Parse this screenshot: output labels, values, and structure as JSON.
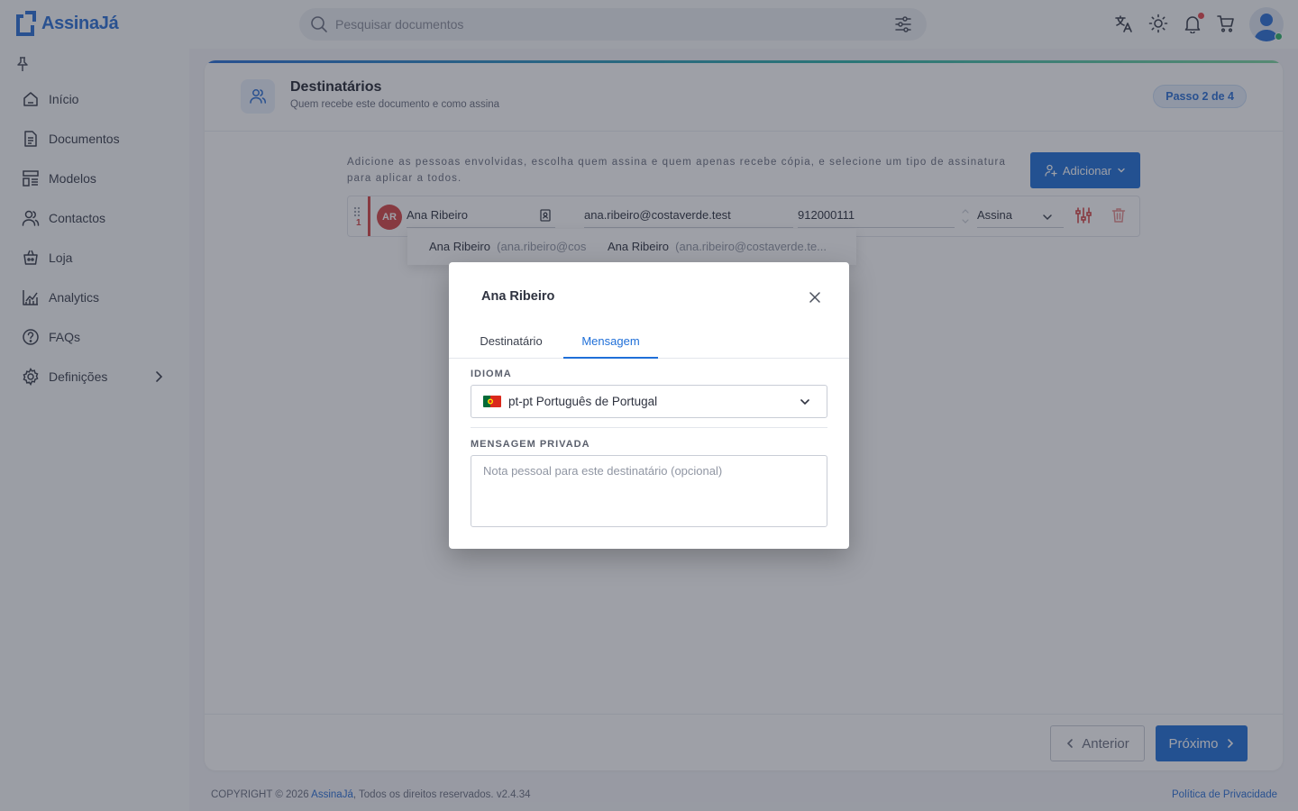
{
  "app": {
    "name": "AssinaJá",
    "brand_color": "#2a6fd6",
    "accent_color": "#1f6fd8"
  },
  "topbar": {
    "search_placeholder": "Pesquisar documentos",
    "icons": [
      "search-icon",
      "filter-icon",
      "translate-icon",
      "theme-icon",
      "bell-icon",
      "cart-icon",
      "user-avatar"
    ]
  },
  "sidebar": {
    "items": [
      {
        "label": "Início",
        "icon": "home-icon"
      },
      {
        "label": "Documentos",
        "icon": "document-icon"
      },
      {
        "label": "Modelos",
        "icon": "template-icon"
      },
      {
        "label": "Contactos",
        "icon": "contacts-icon"
      },
      {
        "label": "Loja",
        "icon": "shop-icon"
      },
      {
        "label": "Analytics",
        "icon": "chart-icon"
      },
      {
        "label": "FAQs",
        "icon": "help-icon"
      },
      {
        "label": "Definições",
        "icon": "gear-icon"
      }
    ]
  },
  "page": {
    "title": "Destinatários",
    "subtitle": "Quem recebe este documento e como assina",
    "step": "Passo 2 de 4",
    "intro": "Adicione as pessoas envolvidas, escolha quem assina e quem apenas recebe cópia, e selecione um tipo de assinatura para aplicar a todos.",
    "add_button": "Adicionar"
  },
  "recipient_row": {
    "order": "1",
    "initials": "AR",
    "name": "Ana Ribeiro",
    "email": "ana.ribeiro@costaverde.test",
    "phone": "912000111",
    "role": "Assina"
  },
  "suggestions": [
    {
      "name": "Ana Ribeiro",
      "email": "(ana.ribeiro@cos"
    },
    {
      "name": "Ana Ribeiro",
      "email": "(ana.ribeiro@costaverde.te..."
    }
  ],
  "footer": {
    "prev": "Anterior",
    "next": "Próximo",
    "copyright_prefix": "COPYRIGHT © 2026",
    "copyright_brand": "AssinaJá",
    "copyright_suffix": ", Todos os direitos reservados.",
    "version": "v2.4.34",
    "privacy": "Política de Privacidade"
  },
  "modal": {
    "title": "Ana Ribeiro",
    "tabs": [
      "Destinatário",
      "Mensagem"
    ],
    "active_tab": "Mensagem",
    "language_label": "IDIOMA",
    "language_value": "pt-pt Português de Portugal",
    "message_label": "MENSAGEM PRIVADA",
    "message_placeholder": "Nota pessoal para este destinatário (opcional)",
    "message_value": ""
  }
}
